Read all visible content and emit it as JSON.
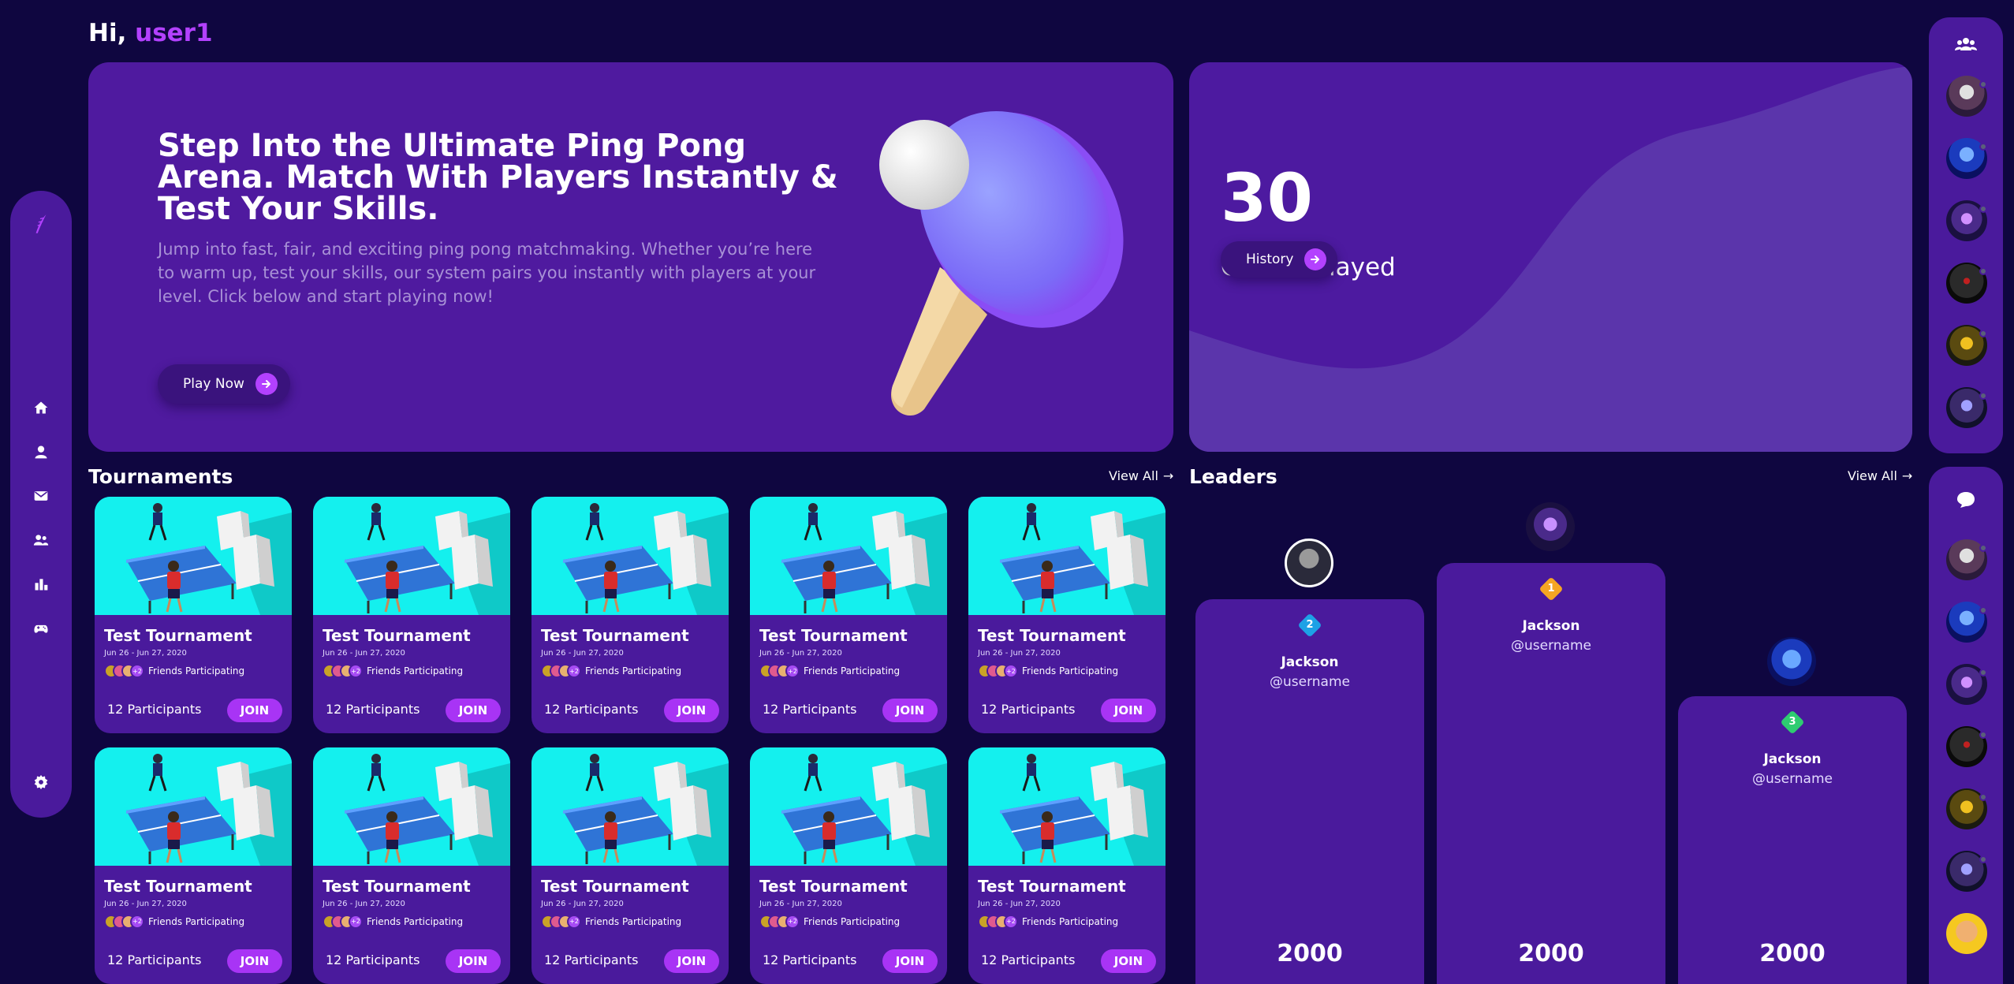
{
  "greeting": {
    "prefix": "Hi, ",
    "username": "user1"
  },
  "nav": {
    "items": [
      {
        "name": "home-icon"
      },
      {
        "name": "profile-icon"
      },
      {
        "name": "mail-icon"
      },
      {
        "name": "friends-icon"
      },
      {
        "name": "leaderboard-icon"
      },
      {
        "name": "game-controller-icon"
      },
      {
        "name": "settings-icon"
      }
    ]
  },
  "hero": {
    "title": "Step Into the Ultimate Ping Pong Arena. Match With Players Instantly & Test Your Skills.",
    "description": "Jump into fast, fair, and exciting ping pong matchmaking. Whether you’re here to warm up, test your skills, our system pairs you instantly with players at your level. Click below and start playing now!",
    "cta_label": "Play Now"
  },
  "stats": {
    "games_played": "30",
    "label": "Games Played",
    "history_label": "History"
  },
  "tournaments": {
    "title": "Tournaments",
    "view_all": "View All",
    "cards": [
      {
        "title": "Test Tournament",
        "date": "Jun 26 - Jun 27, 2020",
        "extra_friends": "+2",
        "friends_label": "Friends Participating",
        "participants": "12 Participants",
        "join": "JOIN"
      },
      {
        "title": "Test Tournament",
        "date": "Jun 26 - Jun 27, 2020",
        "extra_friends": "+2",
        "friends_label": "Friends Participating",
        "participants": "12 Participants",
        "join": "JOIN"
      },
      {
        "title": "Test Tournament",
        "date": "Jun 26 - Jun 27, 2020",
        "extra_friends": "+2",
        "friends_label": "Friends Participating",
        "participants": "12 Participants",
        "join": "JOIN"
      },
      {
        "title": "Test Tournament",
        "date": "Jun 26 - Jun 27, 2020",
        "extra_friends": "+2",
        "friends_label": "Friends Participating",
        "participants": "12 Participants",
        "join": "JOIN"
      },
      {
        "title": "Test Tournament",
        "date": "Jun 26 - Jun 27, 2020",
        "extra_friends": "+2",
        "friends_label": "Friends Participating",
        "participants": "12 Participants",
        "join": "JOIN"
      },
      {
        "title": "Test Tournament",
        "date": "Jun 26 - Jun 27, 2020",
        "extra_friends": "+2",
        "friends_label": "Friends Participating",
        "participants": "12 Participants",
        "join": "JOIN"
      },
      {
        "title": "Test Tournament",
        "date": "Jun 26 - Jun 27, 2020",
        "extra_friends": "+2",
        "friends_label": "Friends Participating",
        "participants": "12 Participants",
        "join": "JOIN"
      },
      {
        "title": "Test Tournament",
        "date": "Jun 26 - Jun 27, 2020",
        "extra_friends": "+2",
        "friends_label": "Friends Participating",
        "participants": "12 Participants",
        "join": "JOIN"
      },
      {
        "title": "Test Tournament",
        "date": "Jun 26 - Jun 27, 2020",
        "extra_friends": "+2",
        "friends_label": "Friends Participating",
        "participants": "12 Participants",
        "join": "JOIN"
      },
      {
        "title": "Test Tournament",
        "date": "Jun 26 - Jun 27, 2020",
        "extra_friends": "+2",
        "friends_label": "Friends Participating",
        "participants": "12 Participants",
        "join": "JOIN"
      }
    ]
  },
  "leaders": {
    "title": "Leaders",
    "view_all": "View All",
    "podium": [
      {
        "rank": "2",
        "name": "Jackson",
        "handle": "@username",
        "score": "2000",
        "color": "#1da1e6"
      },
      {
        "rank": "1",
        "name": "Jackson",
        "handle": "@username",
        "score": "2000",
        "color": "#f5a623"
      },
      {
        "rank": "3",
        "name": "Jackson",
        "handle": "@username",
        "score": "2000",
        "color": "#2ecc71"
      }
    ]
  },
  "sidebar_right": {
    "friends_icon": "group-icon",
    "chat_icon": "chat-icon",
    "friends_count": 6,
    "chats_count": 7
  },
  "colors": {
    "background": "#0f0640",
    "panel": "#4a1a9c",
    "accent": "#b341ff",
    "tournament_image_bg": "#14f0ee"
  }
}
